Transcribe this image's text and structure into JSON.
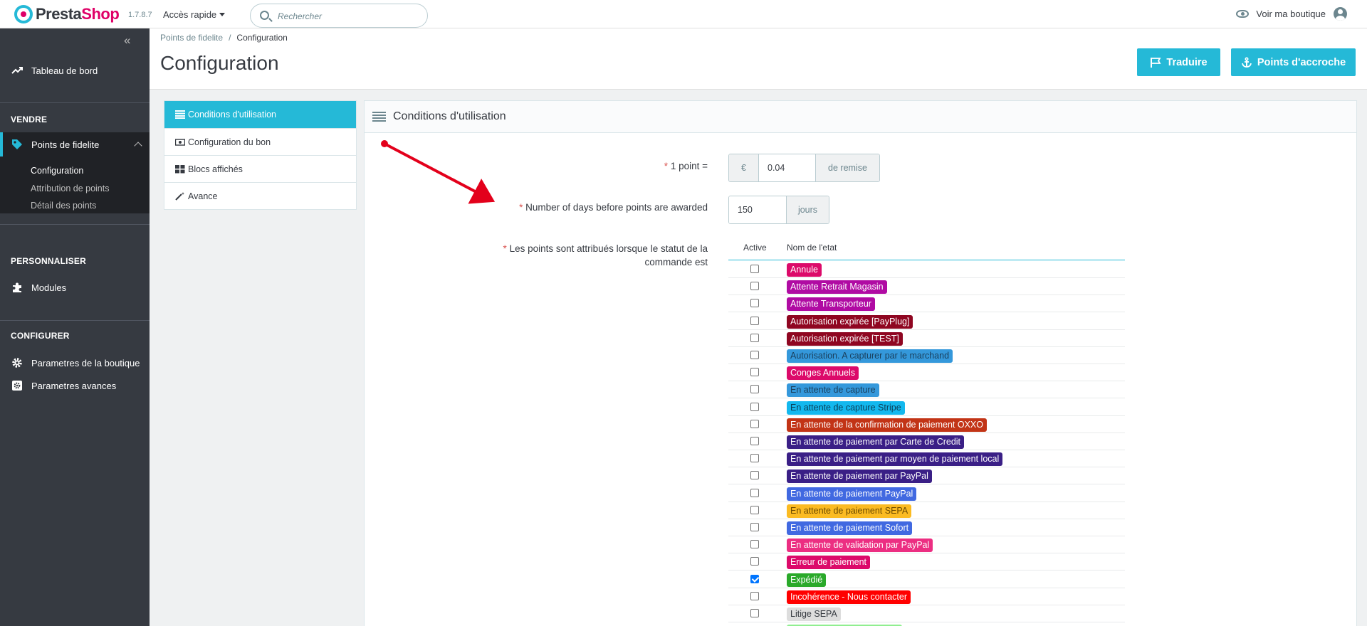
{
  "topbar": {
    "logo_presta": "Presta",
    "logo_shop": "Shop",
    "version": "1.7.8.7",
    "quick_access": "Accès rapide",
    "search_placeholder": "Rechercher",
    "view_shop": "Voir ma boutique"
  },
  "sidebar": {
    "collapse": "«",
    "dashboard": "Tableau de bord",
    "section_sell": "VENDRE",
    "loyalty": "Points de fidelite",
    "sub": [
      "Configuration",
      "Attribution de points",
      "Détail des points"
    ],
    "section_customize": "PERSONNALISER",
    "modules": "Modules",
    "section_configure": "CONFIGURER",
    "shop_params": "Parametres de la boutique",
    "advanced_params": "Parametres avances"
  },
  "header": {
    "breadcrumb_parent": "Points de fidelite",
    "breadcrumb_sep": "/",
    "breadcrumb_current": "Configuration",
    "title": "Configuration",
    "translate": "Traduire",
    "hooks": "Points d'accroche"
  },
  "tabs": [
    "Conditions d'utilisation",
    "Configuration du bon",
    "Blocs affichés",
    "Avance"
  ],
  "panel": {
    "title": "Conditions d'utilisation",
    "point_label": "1 point =",
    "currency": "€",
    "point_value": "0.04",
    "point_suffix": "de remise",
    "days_label": "Number of days before points are awarded",
    "days_value": "150",
    "days_suffix": "jours",
    "status_label_1": "Les points sont attribués lorsque le statut de la",
    "status_label_2": "commande est",
    "col_active": "Active",
    "col_name": "Nom de l'etat"
  },
  "states": [
    {
      "name": "Annule",
      "color": "#dc0a6a",
      "text": "#ffffff",
      "checked": false
    },
    {
      "name": "Attente Retrait Magasin",
      "color": "#b00ba3",
      "text": "#ffffff",
      "checked": false
    },
    {
      "name": "Attente Transporteur",
      "color": "#b00ba3",
      "text": "#ffffff",
      "checked": false
    },
    {
      "name": "Autorisation expirée [PayPlug]",
      "color": "#8f0621",
      "text": "#ffffff",
      "checked": false
    },
    {
      "name": "Autorisation expirée [TEST]",
      "color": "#8f0621",
      "text": "#ffffff",
      "checked": false
    },
    {
      "name": "Autorisation. A capturer par le marchand",
      "color": "#3498db",
      "text": "#1a3f5c",
      "checked": false
    },
    {
      "name": "Conges Annuels",
      "color": "#dc0a6a",
      "text": "#ffffff",
      "checked": false
    },
    {
      "name": "En attente de capture",
      "color": "#3498db",
      "text": "#1a3f5c",
      "checked": false
    },
    {
      "name": "En attente de capture Stripe",
      "color": "#13b8ee",
      "text": "#0b3d55",
      "checked": false
    },
    {
      "name": "En attente de la confirmation de paiement OXXO",
      "color": "#c23416",
      "text": "#ffffff",
      "checked": false
    },
    {
      "name": "En attente de paiement par Carte de Credit",
      "color": "#3a1f86",
      "text": "#ffffff",
      "checked": false
    },
    {
      "name": "En attente de paiement par moyen de paiement local",
      "color": "#3a1f86",
      "text": "#ffffff",
      "checked": false
    },
    {
      "name": "En attente de paiement par PayPal",
      "color": "#3a1f86",
      "text": "#ffffff",
      "checked": false
    },
    {
      "name": "En attente de paiement PayPal",
      "color": "#4169e1",
      "text": "#ffffff",
      "checked": false
    },
    {
      "name": "En attente de paiement SEPA",
      "color": "#fbbb22",
      "text": "#6b4a00",
      "checked": false
    },
    {
      "name": "En attente de paiement Sofort",
      "color": "#4169e1",
      "text": "#ffffff",
      "checked": false
    },
    {
      "name": "En attente de validation par PayPal",
      "color": "#ec2e82",
      "text": "#ffffff",
      "checked": false
    },
    {
      "name": "Erreur de paiement",
      "color": "#dc0a6a",
      "text": "#ffffff",
      "checked": false
    },
    {
      "name": "Expédié",
      "color": "#2aa92a",
      "text": "#ffffff",
      "checked": true
    },
    {
      "name": "Incohérence - Nous contacter",
      "color": "#ff0000",
      "text": "#ffffff",
      "checked": false
    },
    {
      "name": "Litige SEPA",
      "color": "#dddddd",
      "text": "#363a41",
      "checked": false
    },
    {
      "name": "",
      "color": "#90ee90",
      "text": "#363a41",
      "checked": false
    }
  ]
}
